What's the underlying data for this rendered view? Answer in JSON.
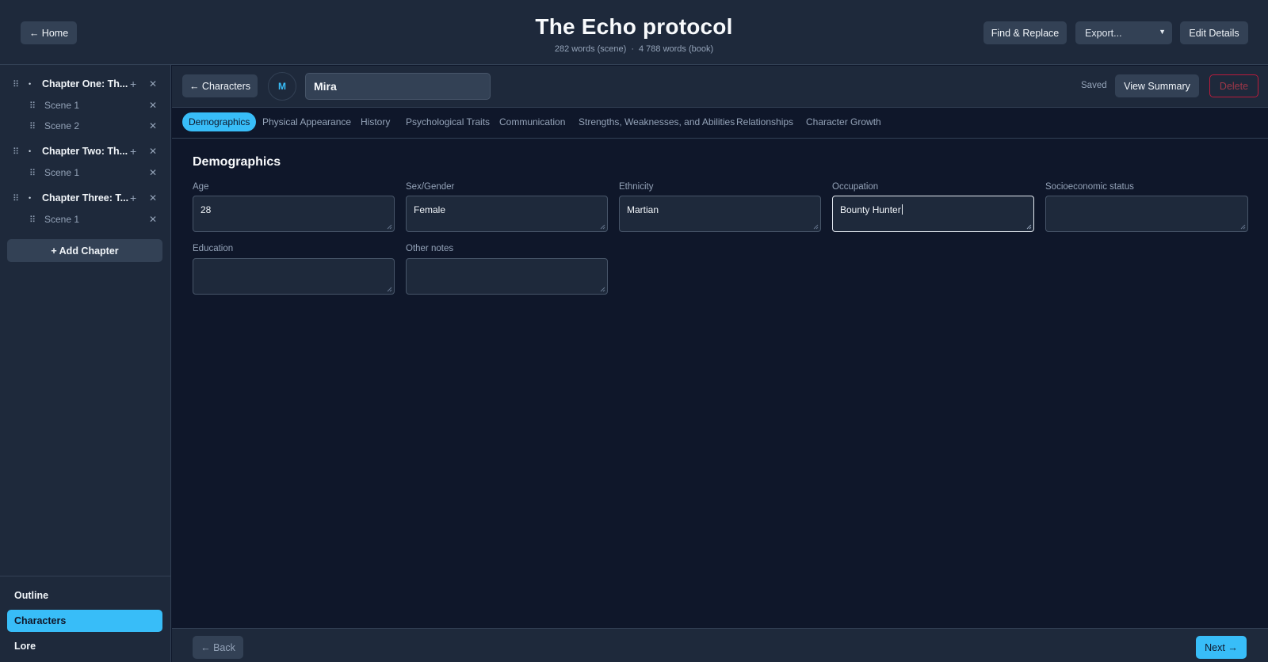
{
  "header": {
    "home_label": "← Home",
    "book_title": "The Echo protocol",
    "scene_words": "282 words (scene)",
    "separator": "·",
    "book_words": "4 788 words (book)",
    "find_replace_label": "Find & Replace",
    "export_selected": "Export...",
    "edit_details_label": "Edit Details"
  },
  "sidebar": {
    "chapters": [
      {
        "title": "Chapter One: Th...",
        "scenes": [
          "Scene 1",
          "Scene 2"
        ]
      },
      {
        "title": "Chapter Two: Th...",
        "scenes": [
          "Scene 1"
        ]
      },
      {
        "title": "Chapter Three: T...",
        "scenes": [
          "Scene 1"
        ]
      }
    ],
    "add_chapter_label": "+ Add Chapter",
    "nav": [
      {
        "label": "Outline",
        "active": false
      },
      {
        "label": "Characters",
        "active": true
      },
      {
        "label": "Lore",
        "active": false
      }
    ]
  },
  "character": {
    "back_label": "← Characters",
    "avatar_initial": "M",
    "name": "Mira",
    "save_status": "Saved",
    "view_summary_label": "View Summary",
    "delete_label": "Delete"
  },
  "tabs": [
    {
      "label": "Demographics",
      "active": true
    },
    {
      "label": "Physical Appearance",
      "active": false
    },
    {
      "label": "History",
      "active": false
    },
    {
      "label": "Psychological Traits",
      "active": false
    },
    {
      "label": "Communication",
      "active": false
    },
    {
      "label": "Strengths, Weaknesses, and Abilities",
      "active": false
    },
    {
      "label": "Relationships",
      "active": false
    },
    {
      "label": "Character Growth",
      "active": false
    }
  ],
  "form": {
    "section_title": "Demographics",
    "fields": [
      {
        "label": "Age",
        "value": "28"
      },
      {
        "label": "Sex/Gender",
        "value": "Female"
      },
      {
        "label": "Ethnicity",
        "value": "Martian"
      },
      {
        "label": "Occupation",
        "value": "Bounty Hunter"
      },
      {
        "label": "Socioeconomic status",
        "value": ""
      },
      {
        "label": "Education",
        "value": ""
      },
      {
        "label": "Other notes",
        "value": ""
      }
    ]
  },
  "footer": {
    "back_label": "← Back",
    "next_label": "Next →"
  },
  "colors": {
    "background": "#0f172a",
    "panel": "#1e293b",
    "accent": "#38bdf8",
    "danger": "#b91c3c"
  },
  "icons": {
    "drag": "drag-handle-icon",
    "close": "close-icon",
    "add": "plus-icon",
    "bullet": "bullet-icon",
    "select": "chevron-down-icon"
  }
}
